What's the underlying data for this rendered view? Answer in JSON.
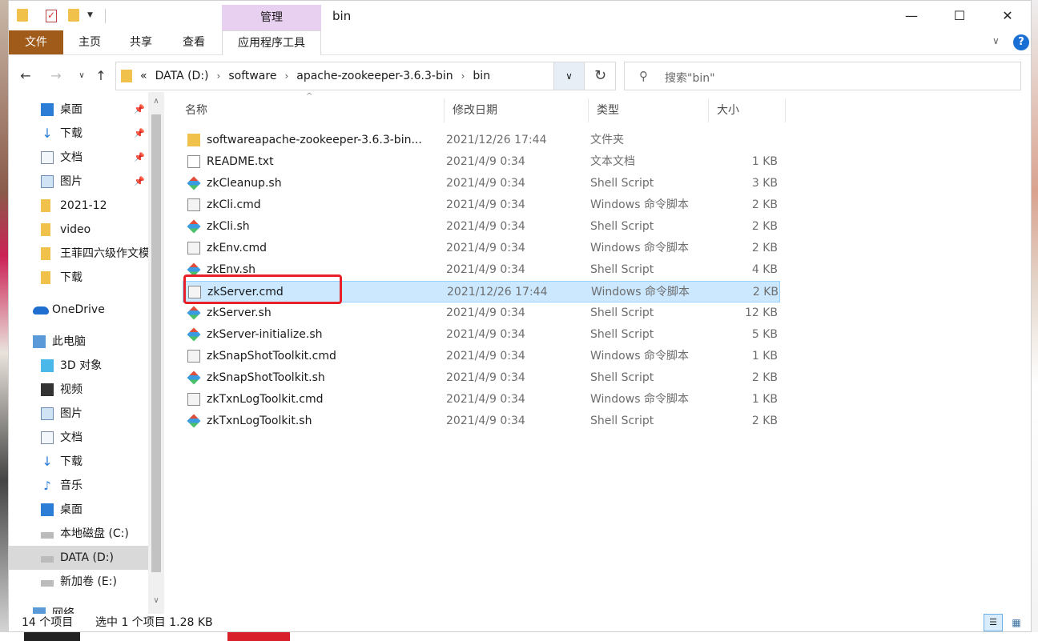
{
  "window": {
    "title": "bin",
    "manage_tab": "管理",
    "controls": {
      "minimize": "—",
      "maximize": "☐",
      "close": "✕"
    }
  },
  "ribbon": {
    "tabs": [
      "文件",
      "主页",
      "共享",
      "查看",
      "应用程序工具"
    ],
    "collapse": "∨",
    "help": "?"
  },
  "nav": {
    "back": "←",
    "forward": "→",
    "recent": "∨",
    "up": "↑",
    "breadcrumb": [
      "«",
      "DATA (D:)",
      "software",
      "apache-zookeeper-3.6.3-bin",
      "bin"
    ],
    "separator": "›",
    "dropdown": "∨",
    "refresh": "↻",
    "search_placeholder": "搜索\"bin\"",
    "search_icon": "⚲"
  },
  "sidebar": {
    "items": [
      {
        "label": "桌面",
        "icon": "desktop-icon",
        "pinned": true
      },
      {
        "label": "下载",
        "icon": "download-icon",
        "pinned": true
      },
      {
        "label": "文档",
        "icon": "document-icon",
        "pinned": true
      },
      {
        "label": "图片",
        "icon": "picture-icon",
        "pinned": true
      },
      {
        "label": "2021-12",
        "icon": "folder-icon"
      },
      {
        "label": "video",
        "icon": "folder-icon"
      },
      {
        "label": "王菲四六级作文模",
        "icon": "folder-icon"
      },
      {
        "label": "下载",
        "icon": "folder-icon"
      },
      {
        "label": "OneDrive",
        "icon": "onedrive-icon"
      },
      {
        "label": "此电脑",
        "icon": "this-pc-icon"
      },
      {
        "label": "3D 对象",
        "icon": "3d-objects-icon"
      },
      {
        "label": "视频",
        "icon": "video-icon"
      },
      {
        "label": "图片",
        "icon": "picture-icon"
      },
      {
        "label": "文档",
        "icon": "document-icon"
      },
      {
        "label": "下载",
        "icon": "download-icon"
      },
      {
        "label": "音乐",
        "icon": "music-icon"
      },
      {
        "label": "桌面",
        "icon": "desktop-icon"
      },
      {
        "label": "本地磁盘 (C:)",
        "icon": "drive-icon"
      },
      {
        "label": "DATA (D:)",
        "icon": "drive-icon",
        "selected": true
      },
      {
        "label": "新加卷 (E:)",
        "icon": "drive-icon"
      },
      {
        "label": "网络",
        "icon": "network-icon"
      }
    ],
    "pin_glyph": "📌",
    "scroll_up": "∧",
    "scroll_down": "∨"
  },
  "columns": {
    "name": "名称",
    "date": "修改日期",
    "type": "类型",
    "size": "大小",
    "sort_indicator": "^"
  },
  "files": [
    {
      "name": "softwareapache-zookeeper-3.6.3-bin...",
      "date": "2021/12/26 17:44",
      "type": "文件夹",
      "size": "",
      "icon": "folder-icon"
    },
    {
      "name": "README.txt",
      "date": "2021/4/9 0:34",
      "type": "文本文档",
      "size": "1 KB",
      "icon": "text-file-icon"
    },
    {
      "name": "zkCleanup.sh",
      "date": "2021/4/9 0:34",
      "type": "Shell Script",
      "size": "3 KB",
      "icon": "shell-script-icon"
    },
    {
      "name": "zkCli.cmd",
      "date": "2021/4/9 0:34",
      "type": "Windows 命令脚本",
      "size": "2 KB",
      "icon": "cmd-file-icon"
    },
    {
      "name": "zkCli.sh",
      "date": "2021/4/9 0:34",
      "type": "Shell Script",
      "size": "2 KB",
      "icon": "shell-script-icon"
    },
    {
      "name": "zkEnv.cmd",
      "date": "2021/4/9 0:34",
      "type": "Windows 命令脚本",
      "size": "2 KB",
      "icon": "cmd-file-icon"
    },
    {
      "name": "zkEnv.sh",
      "date": "2021/4/9 0:34",
      "type": "Shell Script",
      "size": "4 KB",
      "icon": "shell-script-icon"
    },
    {
      "name": "zkServer.cmd",
      "date": "2021/12/26 17:44",
      "type": "Windows 命令脚本",
      "size": "2 KB",
      "icon": "cmd-file-icon",
      "selected": true
    },
    {
      "name": "zkServer.sh",
      "date": "2021/4/9 0:34",
      "type": "Shell Script",
      "size": "12 KB",
      "icon": "shell-script-icon"
    },
    {
      "name": "zkServer-initialize.sh",
      "date": "2021/4/9 0:34",
      "type": "Shell Script",
      "size": "5 KB",
      "icon": "shell-script-icon"
    },
    {
      "name": "zkSnapShotToolkit.cmd",
      "date": "2021/4/9 0:34",
      "type": "Windows 命令脚本",
      "size": "1 KB",
      "icon": "cmd-file-icon"
    },
    {
      "name": "zkSnapShotToolkit.sh",
      "date": "2021/4/9 0:34",
      "type": "Shell Script",
      "size": "2 KB",
      "icon": "shell-script-icon"
    },
    {
      "name": "zkTxnLogToolkit.cmd",
      "date": "2021/4/9 0:34",
      "type": "Windows 命令脚本",
      "size": "1 KB",
      "icon": "cmd-file-icon"
    },
    {
      "name": "zkTxnLogToolkit.sh",
      "date": "2021/4/9 0:34",
      "type": "Shell Script",
      "size": "2 KB",
      "icon": "shell-script-icon"
    }
  ],
  "status": {
    "count": "14 个项目",
    "selection": "选中 1 个项目  1.28 KB",
    "details_view": "☰",
    "large_icons_view": "▦"
  },
  "colors": {
    "accent": "#a05a1a",
    "manage_tab": "#e8d0f0",
    "selection": "#cce8ff",
    "highlight": "#e8202a"
  }
}
